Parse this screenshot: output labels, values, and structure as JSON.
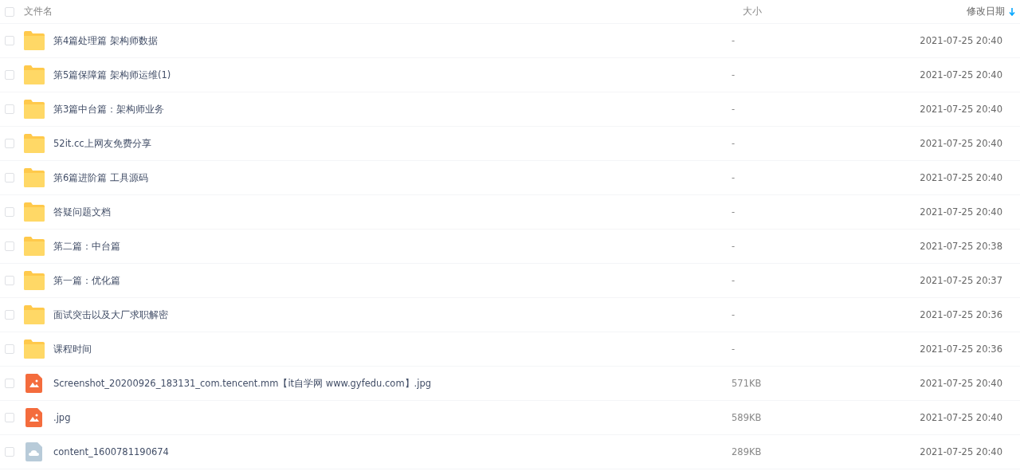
{
  "header": {
    "select_all_checked": false,
    "columns": [
      {
        "label": "文件名",
        "sorted": false
      },
      {
        "label": "大小",
        "sorted": false
      },
      {
        "label": "修改日期",
        "sorted": true
      }
    ]
  },
  "files": [
    {
      "kind": "folder",
      "name": "第4篇处理篇 架构师数据",
      "size": "-",
      "modified": "2021-07-25 20:40",
      "checked": false
    },
    {
      "kind": "folder",
      "name": "第5篇保障篇 架构师运维(1)",
      "size": "-",
      "modified": "2021-07-25 20:40",
      "checked": false
    },
    {
      "kind": "folder",
      "name": "第3篇中台篇：架构师业务",
      "size": "-",
      "modified": "2021-07-25 20:40",
      "checked": false
    },
    {
      "kind": "folder",
      "name": "52it.cc上网友免费分享",
      "size": "-",
      "modified": "2021-07-25 20:40",
      "checked": false
    },
    {
      "kind": "folder",
      "name": "第6篇进阶篇 工具源码",
      "size": "-",
      "modified": "2021-07-25 20:40",
      "checked": false
    },
    {
      "kind": "folder",
      "name": "答疑问题文档",
      "size": "-",
      "modified": "2021-07-25 20:40",
      "checked": false
    },
    {
      "kind": "folder",
      "name": "第二篇：中台篇",
      "size": "-",
      "modified": "2021-07-25 20:38",
      "checked": false
    },
    {
      "kind": "folder",
      "name": "第一篇：优化篇",
      "size": "-",
      "modified": "2021-07-25 20:37",
      "checked": false
    },
    {
      "kind": "folder",
      "name": "面试突击以及大厂求职解密",
      "size": "-",
      "modified": "2021-07-25 20:36",
      "checked": false
    },
    {
      "kind": "folder",
      "name": "课程时间",
      "size": "-",
      "modified": "2021-07-25 20:36",
      "checked": false
    },
    {
      "kind": "image",
      "name": "Screenshot_20200926_183131_com.tencent.mm【it自学网 www.gyfedu.com】.jpg",
      "size": "571KB",
      "modified": "2021-07-25 20:40",
      "checked": false
    },
    {
      "kind": "image",
      "name": ".jpg",
      "size": "589KB",
      "modified": "2021-07-25 20:40",
      "checked": false
    },
    {
      "kind": "cloud",
      "name": "content_1600781190674",
      "size": "289KB",
      "modified": "2021-07-25 20:40",
      "checked": false
    }
  ]
}
